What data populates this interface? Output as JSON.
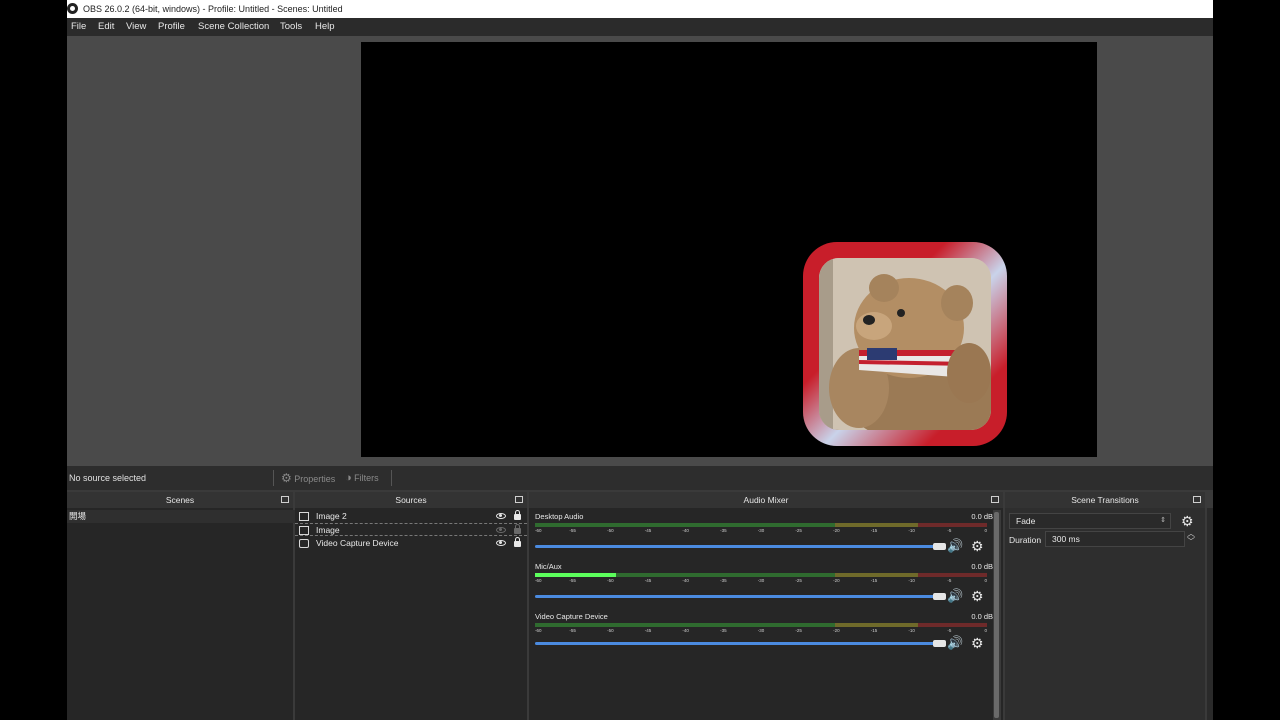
{
  "window": {
    "title": "OBS 26.0.2 (64-bit, windows) - Profile: Untitled - Scenes: Untitled"
  },
  "menu": [
    "File",
    "Edit",
    "View",
    "Profile",
    "Scene Collection",
    "Tools",
    "Help"
  ],
  "status_row": {
    "no_source": "No source selected",
    "properties_label": "Properties",
    "filters_label": "Filters"
  },
  "docks": {
    "scenes": {
      "title": "Scenes",
      "items": [
        "開場"
      ]
    },
    "sources": {
      "title": "Sources",
      "items": [
        {
          "name": "Image 2",
          "icon": "image-icon",
          "visible": true,
          "locked": true
        },
        {
          "name": "Image",
          "icon": "image-icon",
          "visible": false,
          "locked": false
        },
        {
          "name": "Video Capture Device",
          "icon": "camera-icon",
          "visible": true,
          "locked": true
        }
      ]
    },
    "audio_mixer": {
      "title": "Audio Mixer",
      "tick_labels": [
        "-60",
        "-55",
        "-50",
        "-45",
        "-40",
        "-35",
        "-30",
        "-25",
        "-20",
        "-15",
        "-10",
        "-5",
        "0"
      ],
      "channels": [
        {
          "name": "Desktop Audio",
          "db": "0.0 dB",
          "level": 0.0
        },
        {
          "name": "Mic/Aux",
          "db": "0.0 dB",
          "level": 0.18
        },
        {
          "name": "Video Capture Device",
          "db": "0.0 dB",
          "level": 0.0
        }
      ]
    },
    "scene_transitions": {
      "title": "Scene Transitions",
      "transition": "Fade",
      "duration_label": "Duration",
      "duration_value": "300 ms"
    }
  },
  "colors": {
    "frame_red": "#c81e2a",
    "slider_blue": "#4b8be0",
    "meter_green": "#5cff5c"
  }
}
